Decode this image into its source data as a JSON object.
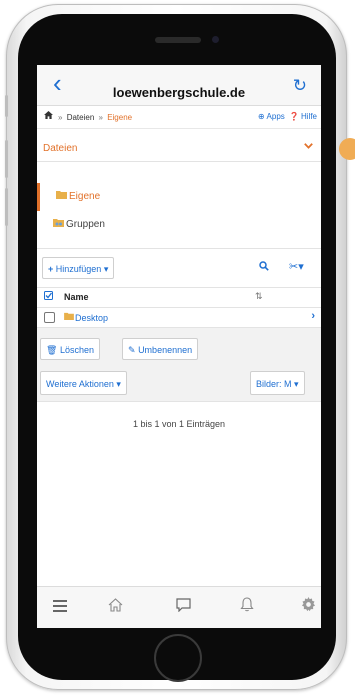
{
  "browser": {
    "back_glyph": "‹",
    "domain": "loewenbergschule.de",
    "reload_glyph": "↻"
  },
  "breadcrumb": {
    "home_icon": "home-icon",
    "sep": "»",
    "items": [
      "Dateien",
      "Eigene"
    ],
    "apps_label": "Apps",
    "help_label": "Hilfe"
  },
  "section": {
    "title": "Dateien",
    "chevron_icon": "chevron-down-icon"
  },
  "nav": {
    "items": [
      {
        "label": "Eigene",
        "icon": "folder-icon",
        "active": true
      },
      {
        "label": "Gruppen",
        "icon": "group-folder-icon",
        "active": false
      }
    ]
  },
  "toolbar": {
    "add_label": "Hinzufügen",
    "add_caret": "▾",
    "search_icon": "search-icon",
    "tools_icon": "tools-icon"
  },
  "table": {
    "column_name": "Name",
    "sort_icon": "sort-icon",
    "rows": [
      {
        "label": "Desktop",
        "icon": "folder-icon"
      }
    ]
  },
  "actions": {
    "delete_label": "Löschen",
    "rename_label": "Umbenennen",
    "more_label": "Weitere Aktionen",
    "images_label": "Bilder: M"
  },
  "pagination": {
    "text": "1 bis 1 von 1 Einträgen"
  },
  "bottom_nav": [
    "menu-icon",
    "home-icon",
    "chat-icon",
    "bell-icon",
    "gear-icon"
  ],
  "colors": {
    "accent": "#e2722b",
    "link": "#1f6fd1"
  }
}
